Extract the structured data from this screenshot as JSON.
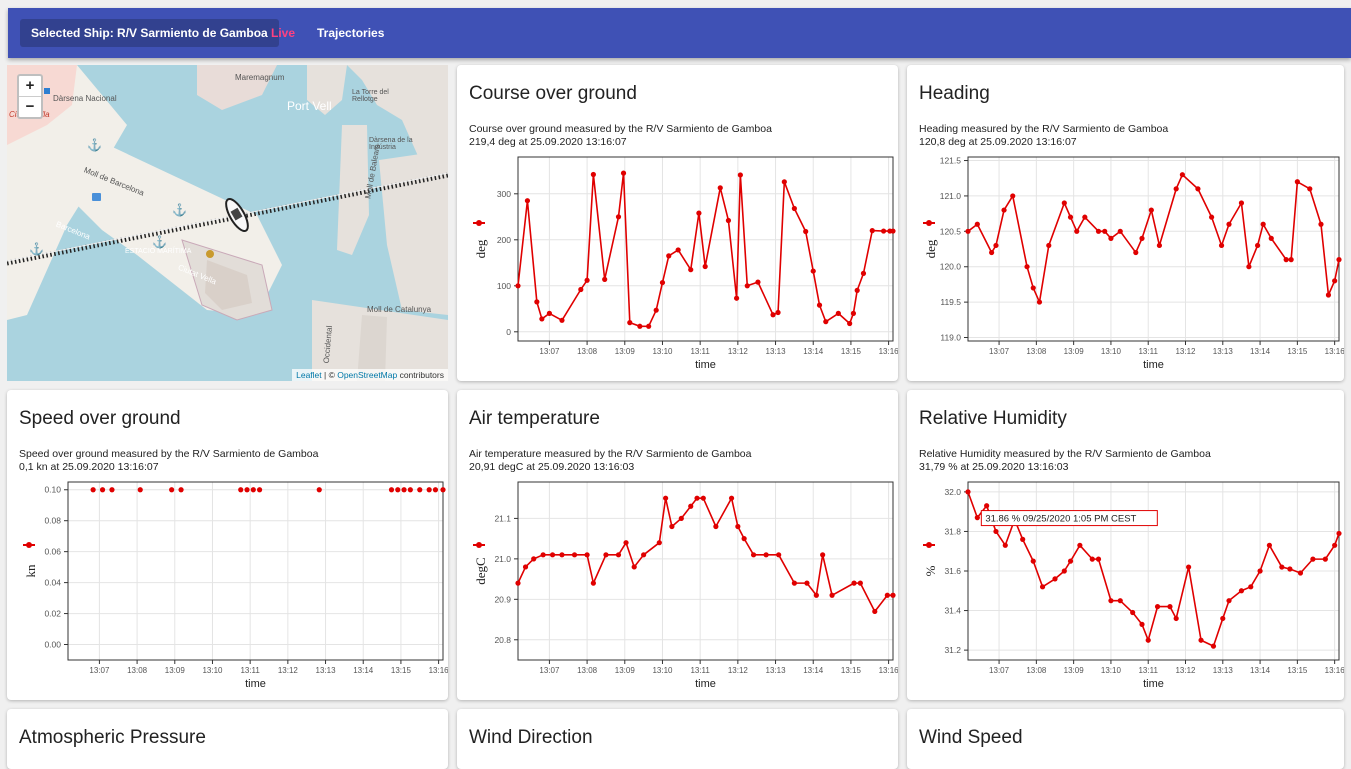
{
  "navbar": {
    "ship_label": "Selected Ship: R/V Sarmiento de Gamboa",
    "live_label": "Live",
    "trajectories_label": "Trajectories"
  },
  "colors": {
    "navbar": "#3f51b5",
    "ship_button": "#32418f",
    "live": "#ff4081",
    "series": "#e00000"
  },
  "map": {
    "zoom_in": "+",
    "zoom_out": "−",
    "attribution_leaflet": "Leaflet",
    "attribution_sep": " | © ",
    "attribution_osm": "OpenStreetMap",
    "attribution_rest": " contributors",
    "labels": [
      "Maremagnum",
      "Dàrsena Nacional",
      "Port Vell",
      "La Torre del Rellotge",
      "Dàrsena de la Indústria",
      "Moll de Barcelona",
      "Ciutat Vella",
      "Moll de Balears",
      "ESTACIÓ MARÍTIMA",
      "Moll de Catalunya",
      "Ciutat Vella",
      "Barcelona",
      "Occidental"
    ]
  },
  "cards": [
    {
      "key": "cog",
      "title": "Course over ground",
      "desc_line1": "Course over ground measured by the R/V Sarmiento de Gamboa",
      "desc_line2": "219,4 deg at 25.09.2020 13:16:07"
    },
    {
      "key": "hdg",
      "title": "Heading",
      "desc_line1": "Heading measured by the R/V Sarmiento de Gamboa",
      "desc_line2": "120,8 deg at 25.09.2020 13:16:07"
    },
    {
      "key": "sog",
      "title": "Speed over ground",
      "desc_line1": "Speed over ground measured by the R/V Sarmiento de Gamboa",
      "desc_line2": "0,1 kn at 25.09.2020 13:16:07"
    },
    {
      "key": "air",
      "title": "Air temperature",
      "desc_line1": "Air temperature measured by the R/V Sarmiento de Gamboa",
      "desc_line2": "20,91 degC at 25.09.2020 13:16:03"
    },
    {
      "key": "rh",
      "title": "Relative Humidity",
      "desc_line1": "Relative Humidity measured by the R/V Sarmiento de Gamboa",
      "desc_line2": "31,79 % at 25.09.2020 13:16:03"
    },
    {
      "key": "ap",
      "title": "Atmospheric Pressure"
    },
    {
      "key": "wd",
      "title": "Wind Direction"
    },
    {
      "key": "ws",
      "title": "Wind Speed"
    }
  ],
  "chart_data": [
    {
      "key": "cog",
      "type": "line",
      "xlabel": "time",
      "ylabel": "deg",
      "x_range": [
        "13:06:10",
        "13:16:07"
      ],
      "ylim": [
        -20,
        380
      ],
      "yticks": [
        0,
        100,
        200,
        300
      ],
      "xticks": [
        "13:07",
        "13:08",
        "13:09",
        "13:10",
        "13:11",
        "13:12",
        "13:13",
        "13:14",
        "13:15",
        "13:16"
      ],
      "x": [
        "13:06:10",
        "13:06:25",
        "13:06:40",
        "13:06:48",
        "13:07:00",
        "13:07:20",
        "13:07:50",
        "13:08:00",
        "13:08:10",
        "13:08:28",
        "13:08:50",
        "13:08:58",
        "13:09:08",
        "13:09:24",
        "13:09:38",
        "13:09:50",
        "13:10:00",
        "13:10:10",
        "13:10:25",
        "13:10:45",
        "13:10:58",
        "13:11:08",
        "13:11:32",
        "13:11:45",
        "13:11:58",
        "13:12:04",
        "13:12:15",
        "13:12:32",
        "13:12:56",
        "13:13:04",
        "13:13:14",
        "13:13:30",
        "13:13:48",
        "13:14:00",
        "13:14:10",
        "13:14:20",
        "13:14:40",
        "13:14:58",
        "13:15:04",
        "13:15:10",
        "13:15:20",
        "13:15:34",
        "13:15:52",
        "13:16:02",
        "13:16:07"
      ],
      "values": [
        100,
        285,
        65,
        28,
        40,
        25,
        92,
        112,
        342,
        114,
        250,
        345,
        20,
        12,
        12,
        47,
        107,
        165,
        178,
        135,
        258,
        142,
        313,
        242,
        73,
        341,
        100,
        108,
        37,
        42,
        326,
        268,
        218,
        132,
        58,
        22,
        40,
        18,
        40,
        90,
        127,
        220,
        219,
        219,
        219
      ]
    },
    {
      "key": "hdg",
      "type": "line",
      "xlabel": "time",
      "ylabel": "deg",
      "x_range": [
        "13:06:10",
        "13:16:07"
      ],
      "ylim": [
        118.95,
        121.55
      ],
      "yticks": [
        119.0,
        119.5,
        120.0,
        120.5,
        121.0,
        121.5
      ],
      "xticks": [
        "13:07",
        "13:08",
        "13:09",
        "13:10",
        "13:11",
        "13:12",
        "13:13",
        "13:14",
        "13:15",
        "13:16"
      ],
      "x": [
        "13:06:10",
        "13:06:25",
        "13:06:48",
        "13:06:55",
        "13:07:08",
        "13:07:22",
        "13:07:45",
        "13:07:55",
        "13:08:05",
        "13:08:20",
        "13:08:45",
        "13:08:55",
        "13:09:05",
        "13:09:18",
        "13:09:40",
        "13:09:50",
        "13:10:00",
        "13:10:15",
        "13:10:40",
        "13:10:50",
        "13:11:05",
        "13:11:18",
        "13:11:45",
        "13:11:55",
        "13:12:20",
        "13:12:42",
        "13:12:58",
        "13:13:10",
        "13:13:30",
        "13:13:42",
        "13:13:56",
        "13:14:05",
        "13:14:18",
        "13:14:42",
        "13:14:50",
        "13:15:00",
        "13:15:20",
        "13:15:38",
        "13:15:50",
        "13:16:00",
        "13:16:07"
      ],
      "values": [
        120.5,
        120.6,
        120.2,
        120.3,
        120.8,
        121.0,
        120.0,
        119.7,
        119.5,
        120.3,
        120.9,
        120.7,
        120.5,
        120.7,
        120.5,
        120.5,
        120.4,
        120.5,
        120.2,
        120.4,
        120.8,
        120.3,
        121.1,
        121.3,
        121.1,
        120.7,
        120.3,
        120.6,
        120.9,
        120.0,
        120.3,
        120.6,
        120.4,
        120.1,
        120.1,
        121.2,
        121.1,
        120.6,
        119.6,
        119.8,
        120.1
      ]
    },
    {
      "key": "sog",
      "type": "scatter",
      "xlabel": "time",
      "ylabel": "kn",
      "x_range": [
        "13:06:10",
        "13:16:07"
      ],
      "ylim": [
        -0.01,
        0.105
      ],
      "yticks": [
        0.0,
        0.02,
        0.04,
        0.06,
        0.08,
        0.1
      ],
      "xticks": [
        "13:07",
        "13:08",
        "13:09",
        "13:10",
        "13:11",
        "13:12",
        "13:13",
        "13:14",
        "13:15",
        "13:16"
      ],
      "x": [
        "13:06:50",
        "13:07:05",
        "13:07:20",
        "13:08:05",
        "13:08:55",
        "13:09:10",
        "13:10:45",
        "13:10:55",
        "13:11:05",
        "13:11:15",
        "13:12:50",
        "13:14:45",
        "13:14:55",
        "13:15:05",
        "13:15:15",
        "13:15:30",
        "13:15:45",
        "13:15:55",
        "13:16:07"
      ],
      "values": [
        0.1,
        0.1,
        0.1,
        0.1,
        0.1,
        0.1,
        0.1,
        0.1,
        0.1,
        0.1,
        0.1,
        0.1,
        0.1,
        0.1,
        0.1,
        0.1,
        0.1,
        0.1,
        0.1
      ]
    },
    {
      "key": "air",
      "type": "line",
      "xlabel": "time",
      "ylabel": "degC",
      "x_range": [
        "13:06:10",
        "13:16:07"
      ],
      "ylim": [
        20.75,
        21.19
      ],
      "yticks": [
        20.8,
        20.9,
        21.0,
        21.1
      ],
      "xticks": [
        "13:07",
        "13:08",
        "13:09",
        "13:10",
        "13:11",
        "13:12",
        "13:13",
        "13:14",
        "13:15",
        "13:16"
      ],
      "x": [
        "13:06:10",
        "13:06:22",
        "13:06:35",
        "13:06:50",
        "13:07:05",
        "13:07:20",
        "13:07:40",
        "13:08:00",
        "13:08:10",
        "13:08:30",
        "13:08:50",
        "13:09:02",
        "13:09:15",
        "13:09:30",
        "13:09:55",
        "13:10:05",
        "13:10:15",
        "13:10:30",
        "13:10:45",
        "13:10:55",
        "13:11:05",
        "13:11:25",
        "13:11:50",
        "13:12:00",
        "13:12:10",
        "13:12:25",
        "13:12:45",
        "13:13:05",
        "13:13:30",
        "13:13:50",
        "13:14:05",
        "13:14:15",
        "13:14:30",
        "13:15:05",
        "13:15:15",
        "13:15:38",
        "13:15:58",
        "13:16:07"
      ],
      "values": [
        20.94,
        20.98,
        21.0,
        21.01,
        21.01,
        21.01,
        21.01,
        21.01,
        20.94,
        21.01,
        21.01,
        21.04,
        20.98,
        21.01,
        21.04,
        21.15,
        21.08,
        21.1,
        21.13,
        21.15,
        21.15,
        21.08,
        21.15,
        21.08,
        21.05,
        21.01,
        21.01,
        21.01,
        20.94,
        20.94,
        20.91,
        21.01,
        20.91,
        20.94,
        20.94,
        20.87,
        20.91,
        20.91
      ]
    },
    {
      "key": "rh",
      "type": "line",
      "xlabel": "time",
      "ylabel": "%",
      "x_range": [
        "13:06:10",
        "13:16:07"
      ],
      "ylim": [
        31.15,
        32.05
      ],
      "yticks": [
        31.2,
        31.4,
        31.6,
        31.8,
        32.0
      ],
      "xticks": [
        "13:07",
        "13:08",
        "13:09",
        "13:10",
        "13:11",
        "13:12",
        "13:13",
        "13:14",
        "13:15",
        "13:16"
      ],
      "x": [
        "13:06:10",
        "13:06:25",
        "13:06:40",
        "13:06:55",
        "13:07:10",
        "13:07:25",
        "13:07:38",
        "13:07:55",
        "13:08:10",
        "13:08:30",
        "13:08:45",
        "13:08:55",
        "13:09:10",
        "13:09:30",
        "13:09:40",
        "13:10:00",
        "13:10:15",
        "13:10:35",
        "13:10:50",
        "13:11:00",
        "13:11:15",
        "13:11:35",
        "13:11:45",
        "13:12:05",
        "13:12:25",
        "13:12:45",
        "13:13:00",
        "13:13:10",
        "13:13:30",
        "13:13:45",
        "13:14:00",
        "13:14:15",
        "13:14:35",
        "13:14:48",
        "13:15:05",
        "13:15:25",
        "13:15:45",
        "13:16:00",
        "13:16:07"
      ],
      "values": [
        32.0,
        31.87,
        31.93,
        31.8,
        31.73,
        31.86,
        31.76,
        31.65,
        31.52,
        31.56,
        31.6,
        31.65,
        31.73,
        31.66,
        31.66,
        31.45,
        31.45,
        31.39,
        31.33,
        31.25,
        31.42,
        31.42,
        31.36,
        31.62,
        31.25,
        31.22,
        31.36,
        31.45,
        31.5,
        31.52,
        31.6,
        31.73,
        31.62,
        31.61,
        31.59,
        31.66,
        31.66,
        31.73,
        31.79
      ]
    }
  ],
  "tooltip": {
    "text": "31.86 % 09/25/2020 1:05 PM CEST"
  }
}
